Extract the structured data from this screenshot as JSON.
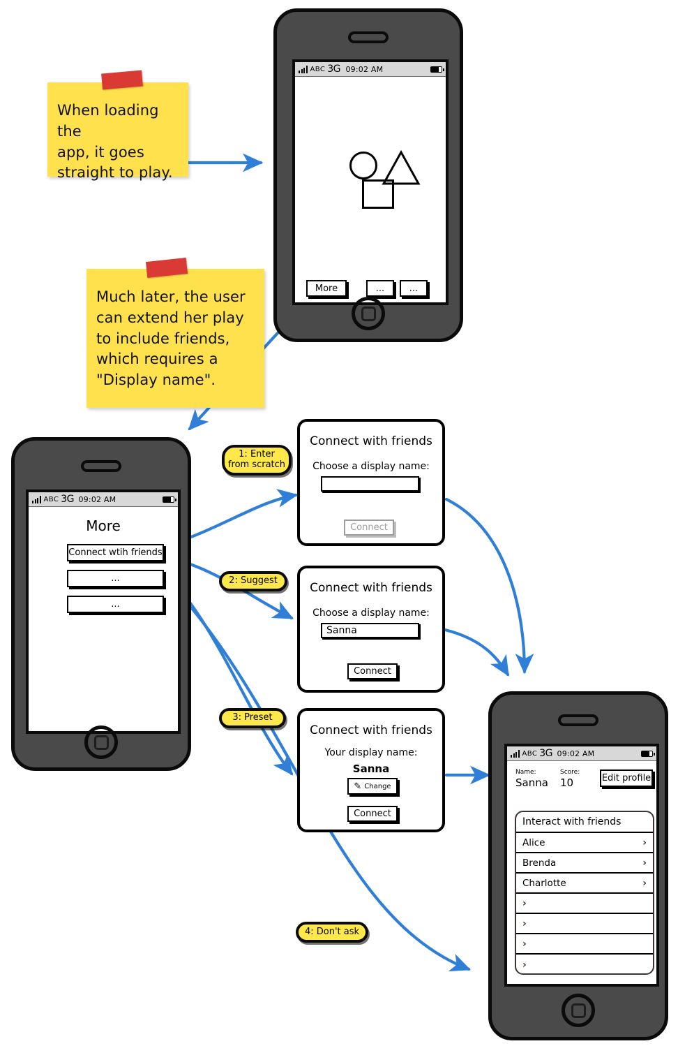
{
  "meta": {
    "diagram_title": "Display name onboarding flow wireframe",
    "accent_blue": "#2f7fd8",
    "sticky_yellow": "#ffe14d",
    "pill_yellow": "#ffe84a",
    "tape_red": "#d93b34",
    "phone_body": "#4a4a4a",
    "outline_black": "#0b0b0b"
  },
  "status_bar": {
    "carrier": "ABC",
    "network": "3G",
    "time": "09:02 AM",
    "signal_icon": "signal-bars-icon",
    "battery_icon": "battery-icon"
  },
  "notes": [
    {
      "id": "note-loading",
      "text": "When loading the\napp, it goes\nstraight to play.",
      "tape_icon": "tape-strip-icon"
    },
    {
      "id": "note-much-later",
      "text": "Much later, the user\ncan extend her play\nto include friends,\nwhich requires a\n\"Display name\".",
      "tape_icon": "tape-strip-icon"
    }
  ],
  "phone_play": {
    "name": "play-screen",
    "shapes": [
      "circle-shape",
      "triangle-shape",
      "square-shape"
    ],
    "buttons": [
      {
        "label": "More",
        "name": "more-button"
      },
      {
        "label": "...",
        "name": "placeholder-button-1"
      },
      {
        "label": "...",
        "name": "placeholder-button-2"
      }
    ]
  },
  "phone_more": {
    "name": "more-screen",
    "title": "More",
    "buttons": [
      {
        "label": "Connect wtih friends",
        "name": "connect-with-friends-button"
      },
      {
        "label": "...",
        "name": "more-placeholder-1"
      },
      {
        "label": "...",
        "name": "more-placeholder-2"
      }
    ]
  },
  "cards": [
    {
      "id": "card-enter-from-scratch",
      "title": "Connect with friends",
      "subtitle": "Choose a display name:",
      "input_value": "",
      "input_placeholder": "",
      "connect_label": "Connect",
      "connect_enabled": false
    },
    {
      "id": "card-suggest",
      "title": "Connect with friends",
      "subtitle": "Choose a display name:",
      "input_value": "Sanna",
      "input_placeholder": "",
      "connect_label": "Connect",
      "connect_enabled": true
    },
    {
      "id": "card-preset",
      "title": "Connect with friends",
      "subtitle": "Your display name:",
      "display_name": "Sanna",
      "change_label": "Change",
      "change_icon": "pencil-icon",
      "connect_label": "Connect",
      "connect_enabled": true
    }
  ],
  "pills": [
    {
      "id": "pill-1",
      "line1": "1: Enter",
      "line2": "from scratch"
    },
    {
      "id": "pill-2",
      "line1": "2: Suggest",
      "line2": ""
    },
    {
      "id": "pill-3",
      "line1": "3: Preset",
      "line2": ""
    },
    {
      "id": "pill-4",
      "line1": "4: Don't ask",
      "line2": ""
    }
  ],
  "phone_profile": {
    "name": "profile-screen",
    "name_label": "Name:",
    "name_value": "Sanna",
    "score_label": "Score:",
    "score_value": "10",
    "edit_profile_label": "Edit profile",
    "list_header": "Interact with friends",
    "friends": [
      "Alice",
      "Brenda",
      "Charlotte"
    ],
    "empty_rows": 4,
    "chevron_icon": "chevron-right-icon"
  }
}
